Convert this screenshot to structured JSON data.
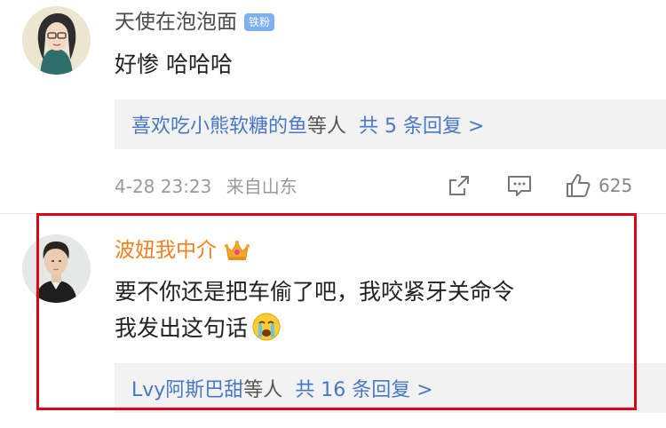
{
  "comments": [
    {
      "username": "天使在泡泡面",
      "badge": "铁粉",
      "text_lines": [
        "好惨 哈哈哈"
      ],
      "reply_preview": {
        "who": "喜欢吃小熊软糖的鱼",
        "etc": "等人",
        "count": "共 5 条回复 >"
      },
      "timestamp": "4-28 23:23",
      "location": "来自山东",
      "likes": "625"
    },
    {
      "username": "波妞我中介",
      "text_lines": [
        "要不你还是把车偷了吧，我咬紧牙关命令",
        "我发出这句话"
      ],
      "reply_preview": {
        "who": "Lvy阿斯巴甜",
        "etc": "等人",
        "count": "共 16 条回复 >"
      }
    }
  ],
  "icons": {
    "share": "share-icon",
    "comment": "comment-icon",
    "like": "thumbs-up-icon",
    "crown": "crown-icon",
    "emoji": "crying-face-emoji"
  },
  "colors": {
    "link_blue": "#4877c5",
    "orange_name": "#f08020",
    "badge_blue": "#7eb0f1",
    "highlight_red": "#e0001a"
  }
}
